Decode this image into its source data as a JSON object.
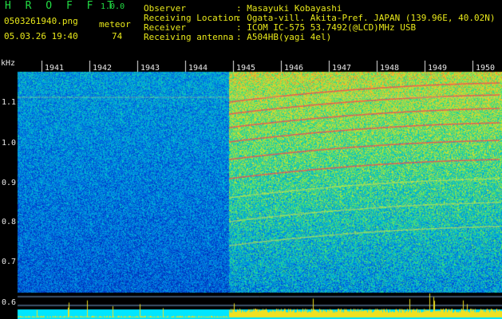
{
  "app": {
    "logo": "H R O F F T",
    "version": "1.0.0"
  },
  "file": {
    "name": "0503261940.png",
    "datetime": "05.03.26 19:40"
  },
  "meteor": {
    "label": "meteor",
    "count": "74"
  },
  "info": [
    {
      "label": "Observer",
      "value": ": Masayuki Kobayashi"
    },
    {
      "label": "Receiving Location",
      "value": ": Ogata-vill. Akita-Pref. JAPAN (139.96E, 40.02N)"
    },
    {
      "label": "Receiver",
      "value": ": ICOM IC-575 53.7492(@LCD)MHz USB"
    },
    {
      "label": "Receiving antenna",
      "value": ": A504HB(yagi 4el)"
    }
  ],
  "axis": {
    "unit": "kHz",
    "freq_ticks": [
      "1.1",
      "1.0",
      "0.9",
      "0.8",
      "0.7",
      "0.6"
    ],
    "minute_ticks": [
      "1941",
      "1942",
      "1943",
      "1944",
      "1945",
      "1946",
      "1947",
      "1948",
      "1949",
      "1950"
    ]
  },
  "colors": {
    "accent_green": "#22dd44",
    "info_yellow": "#e8e81a",
    "trace_cyan": "#00e5ff"
  }
}
